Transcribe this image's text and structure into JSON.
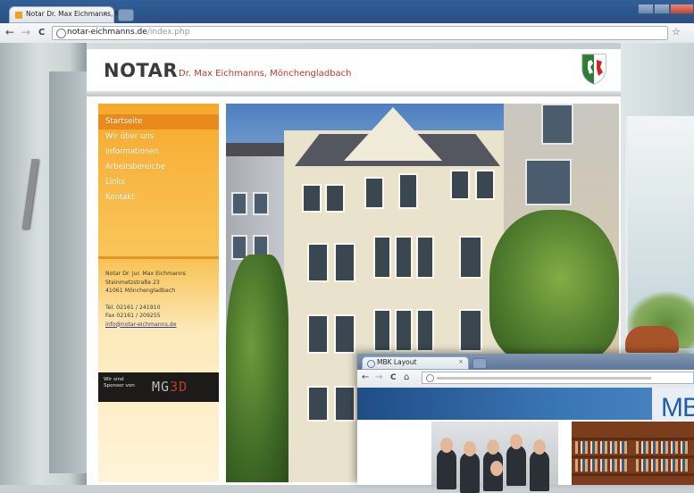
{
  "browser": {
    "tab_title": "Notar Dr. Max Eichmanns, M",
    "tab_close": "×",
    "url_host": "notar-eichmanns.de",
    "url_path": "/index.php",
    "back": "←",
    "forward": "→",
    "reload": "C",
    "star": "☆"
  },
  "site": {
    "brand": "NOTAR",
    "brand_sub": "Dr. Max Eichmanns, Mönchengladbach",
    "menu": [
      {
        "label": "Startseite",
        "active": true
      },
      {
        "label": "Wir über uns"
      },
      {
        "label": "Informationen"
      },
      {
        "label": "Arbeitsbereiche"
      },
      {
        "label": "Links"
      },
      {
        "label": "Kontakt"
      }
    ],
    "contact": {
      "line1": "Notar Dr. jur. Max Eichmanns",
      "line2": "Steinmetzstraße 23",
      "line3": "41061 Mönchengladbach",
      "tel": "Tel. 02161 / 241910",
      "fax": "Fax  02161 / 209255",
      "email": "info@notar-eichmanns.de"
    },
    "sponsor": {
      "line1": "Wir sind",
      "line2": "Sponsor von",
      "logo_a": "MG",
      "logo_b": "3D"
    }
  },
  "overlay": {
    "tab_title": "MBK Layout",
    "tab_close": "×",
    "back": "←",
    "forward": "→",
    "reload": "C",
    "home": "⌂",
    "banner_text": "MB"
  },
  "colors": {
    "accent_orange": "#f6a92c",
    "active_menu": "#e98a1c",
    "brand_red": "#c0392b"
  }
}
